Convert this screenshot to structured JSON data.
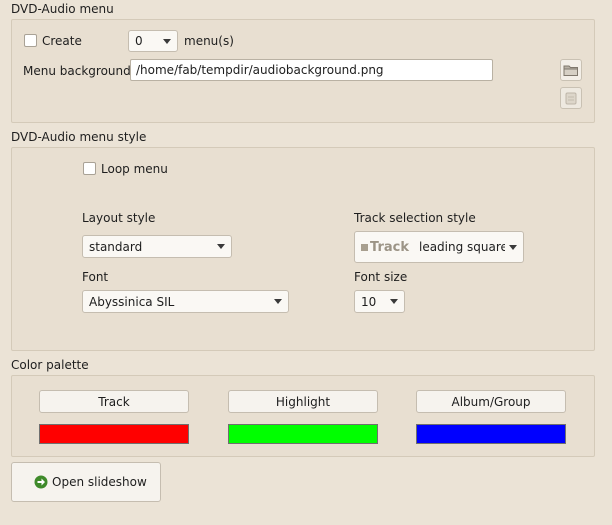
{
  "dvd_audio_menu": {
    "title": "DVD-Audio menu",
    "create_label": "Create",
    "menu_count": "0",
    "menus_suffix": "menu(s)",
    "background_label": "Menu background",
    "background_path": "/home/fab/tempdir/audiobackground.png",
    "browse_icon": "folder-open-icon",
    "clear_icon": "clear-icon"
  },
  "menu_style": {
    "title": "DVD-Audio menu style",
    "loop_label": "Loop menu",
    "layout_label": "Layout style",
    "layout_value": "standard",
    "track_selection_label": "Track selection style",
    "track_preview_text": "Track",
    "track_selection_value": "leading square",
    "font_label": "Font",
    "font_value": "Abyssinica SIL",
    "font_size_label": "Font size",
    "font_size_value": "10"
  },
  "palette": {
    "title": "Color palette",
    "track_label": "Track",
    "highlight_label": "Highlight",
    "album_label": "Album/Group",
    "track_color": "#ff0000",
    "highlight_color": "#00ff00",
    "album_color": "#0000ff"
  },
  "footer": {
    "open_slideshow_label": "Open slideshow",
    "open_icon": "arrow-right-circle-icon"
  }
}
